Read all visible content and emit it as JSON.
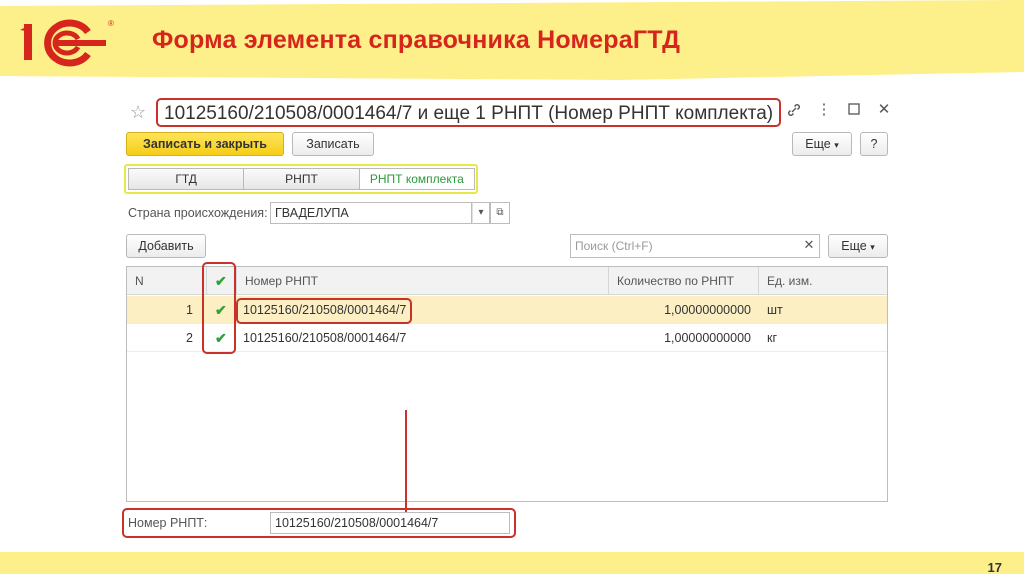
{
  "slide": {
    "title": "Форма элемента справочника НомераГТД",
    "page_number": "17",
    "colors": {
      "title": "#d6251c",
      "band": "#fdf08a"
    }
  },
  "form": {
    "title": "10125160/210508/0001464/7 и еще 1 РНПТ (Номер РНПТ комплекта)",
    "favorite_icon": "star-icon",
    "window_icons": [
      "link-icon",
      "more-icon",
      "maximize-icon",
      "close-icon"
    ],
    "toolbar": {
      "save_close_label": "Записать и закрыть",
      "save_label": "Записать",
      "more_label": "Еще",
      "help_label": "?"
    },
    "tabs": [
      {
        "label": "ГТД",
        "active": false
      },
      {
        "label": "РНПТ",
        "active": false
      },
      {
        "label": "РНПТ комплекта",
        "active": true
      }
    ],
    "country": {
      "label": "Страна происхождения:",
      "value": "ГВАДЕЛУПА"
    },
    "table_toolbar": {
      "add_label": "Добавить",
      "search_placeholder": "Поиск (Ctrl+F)",
      "more_label": "Еще"
    },
    "table": {
      "columns": [
        "N",
        "",
        "Номер РНПТ",
        "Количество по РНПТ",
        "Ед. изм."
      ],
      "rows": [
        {
          "n": "1",
          "checked": true,
          "number": "10125160/210508/0001464/7",
          "qty": "1,00000000000",
          "unit": "шт",
          "selected": true
        },
        {
          "n": "2",
          "checked": true,
          "number": "10125160/210508/0001464/7",
          "qty": "1,00000000000",
          "unit": "кг",
          "selected": false
        }
      ]
    },
    "footer_field": {
      "label": "Номер РНПТ:",
      "value": "10125160/210508/0001464/7"
    }
  }
}
